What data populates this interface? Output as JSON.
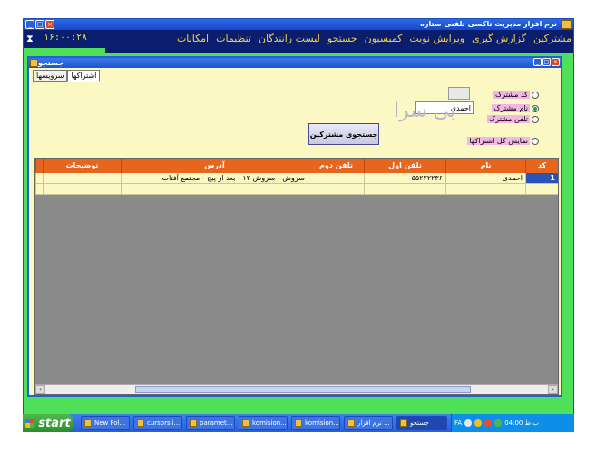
{
  "app": {
    "title": "نرم افزار مدیریت تاکسی تلفنی ستاره",
    "clock": "۱۶:۰۰:۲۸",
    "menu": [
      "مشترکین",
      "گزارش گیری",
      "ویرایش نوبت",
      "کمیسیون",
      "جستجو",
      "لیست رانندگان",
      "تنظیمات",
      "امکانات"
    ]
  },
  "search_window": {
    "title": "جستجو",
    "tabs": [
      "اشتراکها",
      "سرویسها"
    ],
    "options": {
      "by_code": "کد مشترک",
      "by_name": "نام مشترک",
      "by_phone": "تلفن مشترک",
      "show_all": "نمایش کل اشتراکها"
    },
    "name_value": "احمدی",
    "watermark": "بی سرا",
    "search_button": "جستجوی مشترکین",
    "grid": {
      "columns": [
        "کد",
        "نام",
        "تلفن اول",
        "تلفن دوم",
        "آدرس",
        "توضیحات"
      ],
      "rows": [
        {
          "code": "1",
          "name": "احمدی",
          "phone1": "۵۵۲۲۲۲۳۶",
          "phone2": "",
          "address": "سروش - سروش ۱۲ - بعد از پیچ - مجتمع آفتاب",
          "notes": ""
        }
      ]
    }
  },
  "taskbar": {
    "start": "start",
    "tasks": [
      "New Fol...",
      "cursorsli...",
      "paramet...",
      "komision...",
      "komision...",
      "نرم افزار ...",
      "جستجو"
    ],
    "tray": {
      "lang": "FA",
      "time": "04:00 ب.ظ"
    }
  },
  "colors": {
    "window_bg": "#4fe05a",
    "menubar": "#0b1e6e",
    "menu_text": "#f3d24a",
    "panel_bg": "#fbf8c4",
    "grid_header": "#e8651e",
    "grid_body": "#8a8a8a",
    "title_blue": "#2360d8"
  }
}
